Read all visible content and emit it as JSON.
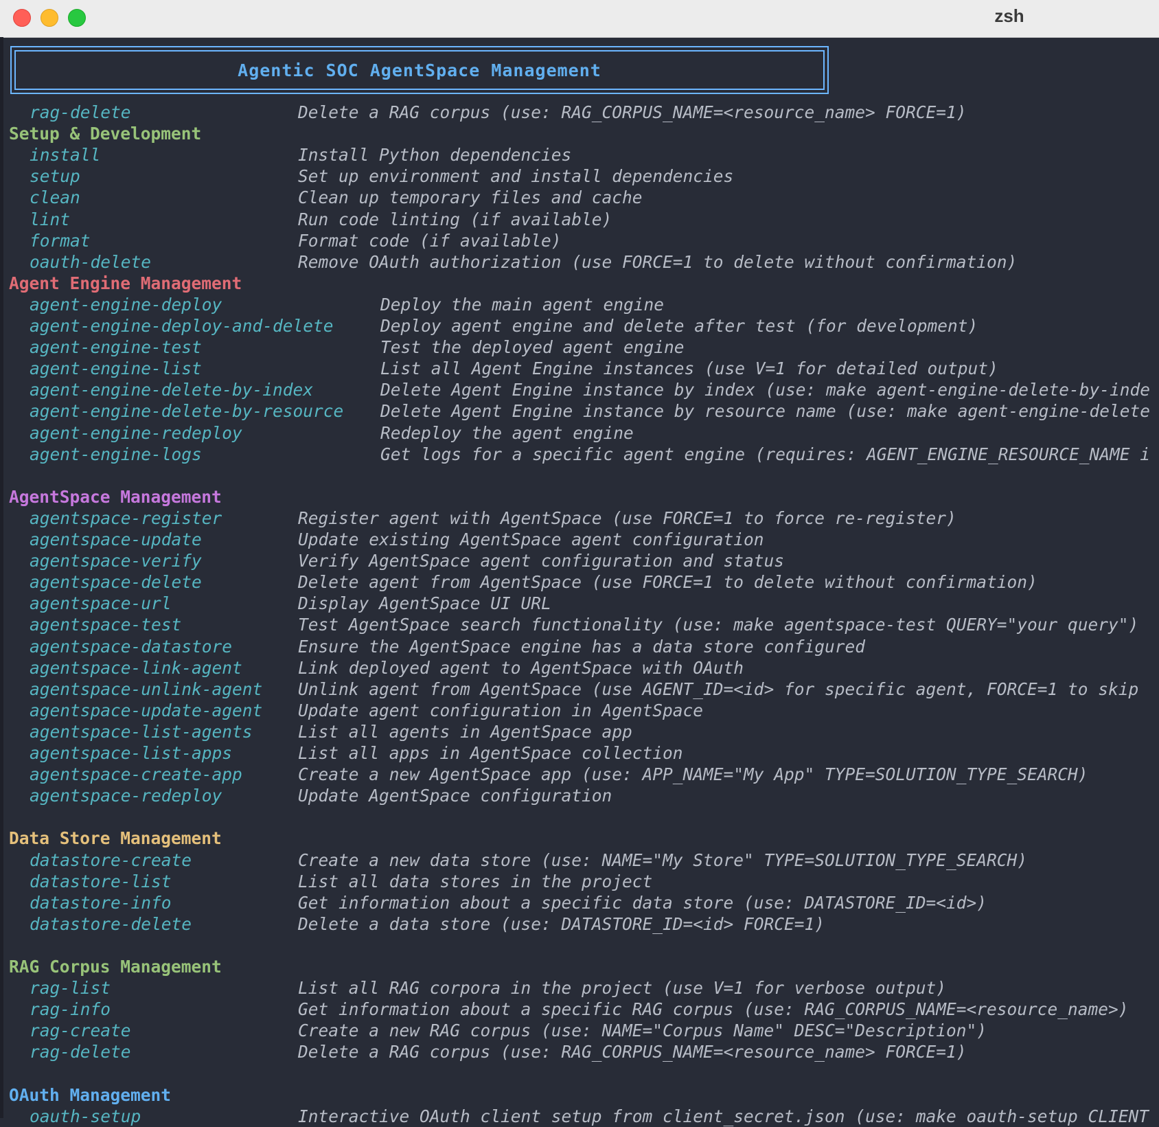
{
  "window": {
    "title": "zsh"
  },
  "banner": {
    "title": "Agentic SOC AgentSpace Management"
  },
  "colors": {
    "background": "#282c37",
    "command": "#56b6c2",
    "description": "#b7bcc6",
    "banner": "#61afef",
    "setup_header": "#98c379",
    "agent_engine_header": "#e06c75",
    "agentspace_header": "#c678dd",
    "datastore_header": "#e5c07b",
    "rag_header": "#98c379",
    "oauth_header": "#61afef"
  },
  "lines": {
    "top_rag_delete": {
      "cmd": "rag-delete",
      "desc": "Delete a RAG corpus (use: RAG_CORPUS_NAME=<resource_name> FORCE=1)"
    },
    "setup": {
      "header": "Setup & Development",
      "items": [
        {
          "cmd": "install",
          "desc": "Install Python dependencies"
        },
        {
          "cmd": "setup",
          "desc": "Set up environment and install dependencies"
        },
        {
          "cmd": "clean",
          "desc": "Clean up temporary files and cache"
        },
        {
          "cmd": "lint",
          "desc": "Run code linting (if available)"
        },
        {
          "cmd": "format",
          "desc": "Format code (if available)"
        },
        {
          "cmd": "oauth-delete",
          "desc": "Remove OAuth authorization (use FORCE=1 to delete without confirmation)"
        }
      ]
    },
    "agent_engine": {
      "header": "Agent Engine Management",
      "items": [
        {
          "cmd": "agent-engine-deploy",
          "desc": "Deploy the main agent engine"
        },
        {
          "cmd": "agent-engine-deploy-and-delete",
          "desc": "Deploy agent engine and delete after test (for development)"
        },
        {
          "cmd": "agent-engine-test",
          "desc": "Test the deployed agent engine"
        },
        {
          "cmd": "agent-engine-list",
          "desc": "List all Agent Engine instances (use V=1 for detailed output)"
        },
        {
          "cmd": "agent-engine-delete-by-index",
          "desc": "Delete Agent Engine instance by index (use: make agent-engine-delete-by-inde"
        },
        {
          "cmd": "agent-engine-delete-by-resource",
          "desc": "Delete Agent Engine instance by resource name (use: make agent-engine-delete"
        },
        {
          "cmd": "agent-engine-redeploy",
          "desc": "Redeploy the agent engine"
        },
        {
          "cmd": "agent-engine-logs",
          "desc": "Get logs for a specific agent engine (requires: AGENT_ENGINE_RESOURCE_NAME i"
        }
      ]
    },
    "agentspace": {
      "header": "AgentSpace Management",
      "items": [
        {
          "cmd": "agentspace-register",
          "desc": "Register agent with AgentSpace (use FORCE=1 to force re-register)"
        },
        {
          "cmd": "agentspace-update",
          "desc": "Update existing AgentSpace agent configuration"
        },
        {
          "cmd": "agentspace-verify",
          "desc": "Verify AgentSpace agent configuration and status"
        },
        {
          "cmd": "agentspace-delete",
          "desc": "Delete agent from AgentSpace (use FORCE=1 to delete without confirmation)"
        },
        {
          "cmd": "agentspace-url",
          "desc": "Display AgentSpace UI URL"
        },
        {
          "cmd": "agentspace-test",
          "desc": "Test AgentSpace search functionality (use: make agentspace-test QUERY=\"your query\")"
        },
        {
          "cmd": "agentspace-datastore",
          "desc": "Ensure the AgentSpace engine has a data store configured"
        },
        {
          "cmd": "agentspace-link-agent",
          "desc": "Link deployed agent to AgentSpace with OAuth"
        },
        {
          "cmd": "agentspace-unlink-agent",
          "desc": "Unlink agent from AgentSpace (use AGENT_ID=<id> for specific agent, FORCE=1 to skip"
        },
        {
          "cmd": "agentspace-update-agent",
          "desc": "Update agent configuration in AgentSpace"
        },
        {
          "cmd": "agentspace-list-agents",
          "desc": "List all agents in AgentSpace app"
        },
        {
          "cmd": "agentspace-list-apps",
          "desc": "List all apps in AgentSpace collection"
        },
        {
          "cmd": "agentspace-create-app",
          "desc": "Create a new AgentSpace app (use: APP_NAME=\"My App\" TYPE=SOLUTION_TYPE_SEARCH)"
        },
        {
          "cmd": "agentspace-redeploy",
          "desc": "Update AgentSpace configuration"
        }
      ]
    },
    "datastore": {
      "header": "Data Store Management",
      "items": [
        {
          "cmd": "datastore-create",
          "desc": "Create a new data store (use: NAME=\"My Store\" TYPE=SOLUTION_TYPE_SEARCH)"
        },
        {
          "cmd": "datastore-list",
          "desc": "List all data stores in the project"
        },
        {
          "cmd": "datastore-info",
          "desc": "Get information about a specific data store (use: DATASTORE_ID=<id>)"
        },
        {
          "cmd": "datastore-delete",
          "desc": "Delete a data store (use: DATASTORE_ID=<id> FORCE=1)"
        }
      ]
    },
    "rag": {
      "header": "RAG Corpus Management",
      "items": [
        {
          "cmd": "rag-list",
          "desc": "List all RAG corpora in the project (use V=1 for verbose output)"
        },
        {
          "cmd": "rag-info",
          "desc": "Get information about a specific RAG corpus (use: RAG_CORPUS_NAME=<resource_name>)"
        },
        {
          "cmd": "rag-create",
          "desc": "Create a new RAG corpus (use: NAME=\"Corpus Name\" DESC=\"Description\")"
        },
        {
          "cmd": "rag-delete",
          "desc": "Delete a RAG corpus (use: RAG_CORPUS_NAME=<resource_name> FORCE=1)"
        }
      ]
    },
    "oauth": {
      "header": "OAuth Management",
      "items": [
        {
          "cmd": "oauth-setup",
          "desc": "Interactive OAuth client setup from client_secret.json (use: make oauth-setup CLIENT"
        }
      ]
    }
  }
}
